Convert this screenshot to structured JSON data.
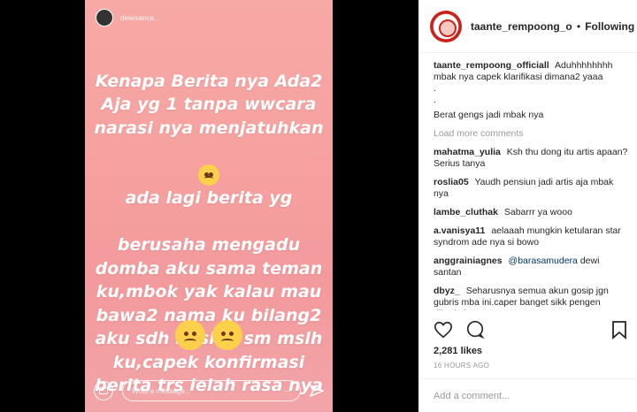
{
  "story": {
    "username": "dewisanca...",
    "text": "Kenapa Berita nya Ada2\nAja yg 1 tanpa wwcara\nnarasi nya menjatuhkan",
    "text2": "ada lagi berita yg",
    "text3": "berusaha mengadu\ndomba aku sama teman\nku,mbok yak kalau mau\nbawa2 nama ku bilang2\naku sdh Pusink sm mslh\nku,capek konfirmasi\nberita trs lelah rasa nya",
    "message_placeholder": "Write a message...",
    "colors": {
      "gradient_top": "#f7a9a6",
      "gradient_bottom": "#f2a5a8"
    }
  },
  "post": {
    "author": "taante_rempoong_offic...",
    "follow_label": "Following",
    "separator": "•",
    "caption_user": "taante_rempoong_officiall",
    "caption_lines": [
      "Aduhhhhhhhh mbak nya capek klarifikasi dimana2 yaaa",
      ".",
      ".",
      "Berat gengs jadi mbak nya"
    ],
    "load_more": "Load more comments",
    "comments": [
      {
        "user": "mahatma_yulia",
        "text": "Ksh thu dong itu artis apaan? Serius tanya"
      },
      {
        "user": "roslia05",
        "text": "Yaudh pensiun jadi artis aja mbak nya"
      },
      {
        "user": "lambe_cluthak",
        "text": "Sabarrr ya wooo"
      },
      {
        "user": "a.vanisya11",
        "text": "aelaaah mungkin ketularan star syndrom ade nya si bowo"
      },
      {
        "user": "anggrainiagnes",
        "mention": "@barasamudera",
        "text": "dewi santan"
      },
      {
        "user": "dbyz_",
        "text": "Seharusnya semua akun gosip jgn gubris mba ini.caper banget sikk pengen diberitain terus"
      }
    ],
    "likes": "2,281 likes",
    "time": "16 HOURS AGO",
    "add_comment": "Add a comment..."
  }
}
